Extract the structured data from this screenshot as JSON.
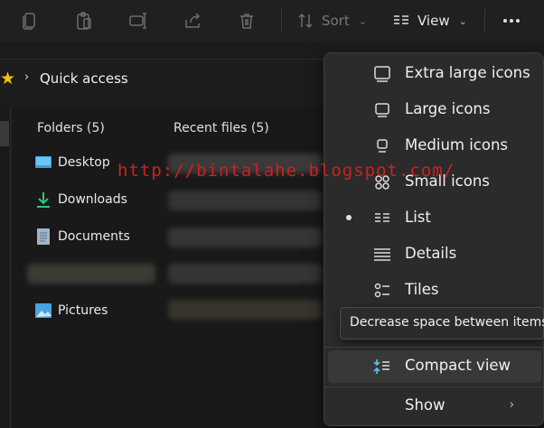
{
  "toolbar": {
    "sort_label": "Sort",
    "view_label": "View",
    "icons": [
      "copy-icon",
      "paste-icon",
      "rename-icon",
      "share-icon",
      "delete-icon",
      "sort-icon",
      "view-icon",
      "more-icon"
    ]
  },
  "address": {
    "location": "Quick access"
  },
  "quick_access": {
    "folders_header": "Folders (5)",
    "recent_header": "Recent files (5)",
    "folders": [
      {
        "name": "Desktop",
        "icon": "desktop-icon"
      },
      {
        "name": "Downloads",
        "icon": "downloads-icon"
      },
      {
        "name": "Documents",
        "icon": "documents-icon"
      },
      {
        "name": "Pictures",
        "icon": "pictures-icon"
      }
    ]
  },
  "watermark": "http://bintalahe.blogspot.com/",
  "view_menu": {
    "items": [
      {
        "label": "Extra large icons",
        "icon": "extra-large-icons-icon"
      },
      {
        "label": "Large icons",
        "icon": "large-icons-icon"
      },
      {
        "label": "Medium icons",
        "icon": "medium-icons-icon"
      },
      {
        "label": "Small icons",
        "icon": "small-icons-icon"
      },
      {
        "label": "List",
        "icon": "list-icon",
        "selected": true
      },
      {
        "label": "Details",
        "icon": "details-icon"
      },
      {
        "label": "Tiles",
        "icon": "tiles-icon"
      },
      {
        "label": "Compact view",
        "icon": "compact-view-icon"
      },
      {
        "label": "Show",
        "icon": "chevron-right-icon"
      }
    ],
    "tooltip": "Decrease space between items"
  },
  "colors": {
    "accent": "#60cdff",
    "star": "#f4c20d",
    "watermark": "#d21f1f"
  }
}
